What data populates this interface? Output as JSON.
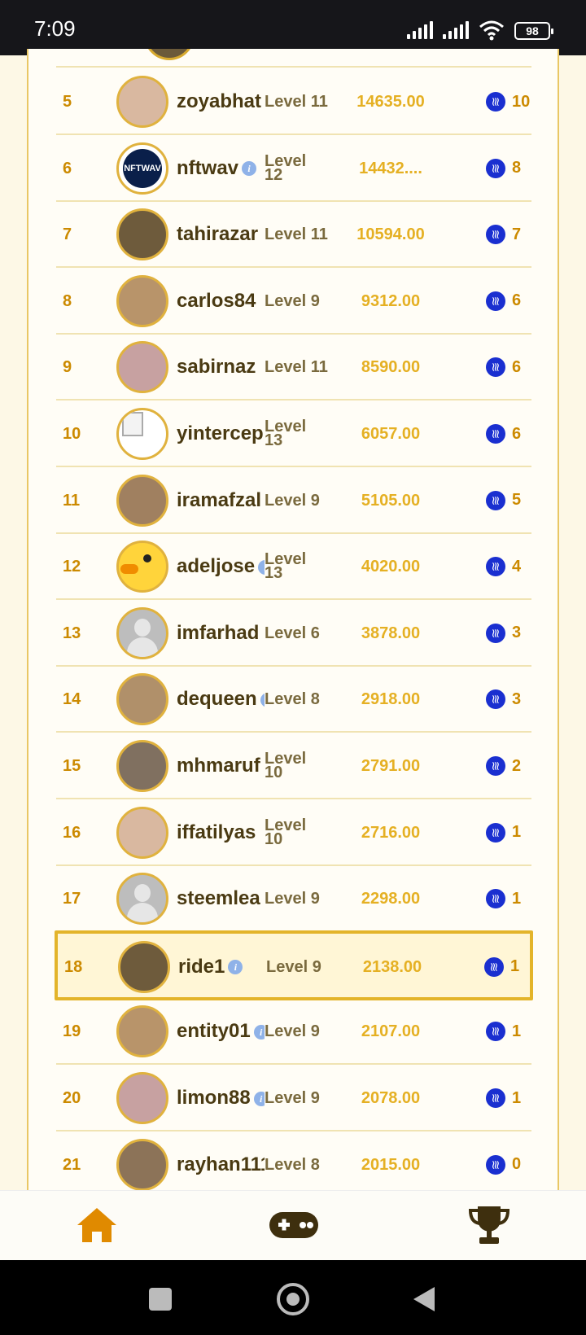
{
  "status_bar": {
    "time": "7:09",
    "battery": "98"
  },
  "colors": {
    "accent": "#e5b023",
    "rank": "#cc8a00",
    "name": "#4a3a12",
    "steem": "#1a2fd0",
    "highlight_border": "#e3b42a"
  },
  "leaderboard": [
    {
      "rank": "5",
      "name": "zoyabhat",
      "level": "Level 11",
      "score": "14635.00",
      "reward": "10",
      "avatar": "photo",
      "info": false
    },
    {
      "rank": "6",
      "name": "nftwav",
      "level": "Level 12",
      "score": "14432....",
      "reward": "8",
      "avatar": "nft-logo",
      "avatar_text": "NFTWAV",
      "info": true
    },
    {
      "rank": "7",
      "name": "tahirazar",
      "level": "Level 11",
      "score": "10594.00",
      "reward": "7",
      "avatar": "photo",
      "info": false
    },
    {
      "rank": "8",
      "name": "carlos84",
      "level": "Level 9",
      "score": "9312.00",
      "reward": "6",
      "avatar": "photo",
      "info": false
    },
    {
      "rank": "9",
      "name": "sabirnaz",
      "level": "Level 11",
      "score": "8590.00",
      "reward": "6",
      "avatar": "photo",
      "info": false
    },
    {
      "rank": "10",
      "name": "yintercep",
      "level": "Level 13",
      "score": "6057.00",
      "reward": "6",
      "avatar": "broken-image",
      "info": false
    },
    {
      "rank": "11",
      "name": "iramafzal",
      "level": "Level 9",
      "score": "5105.00",
      "reward": "5",
      "avatar": "photo",
      "info": false
    },
    {
      "rank": "12",
      "name": "adeljose",
      "level": "Level 13",
      "score": "4020.00",
      "reward": "4",
      "avatar": "duck",
      "info": true
    },
    {
      "rank": "13",
      "name": "imfarhad",
      "level": "Level 6",
      "score": "3878.00",
      "reward": "3",
      "avatar": "default",
      "info": false
    },
    {
      "rank": "14",
      "name": "dequeen",
      "level": "Level 8",
      "score": "2918.00",
      "reward": "3",
      "avatar": "photo",
      "info": true
    },
    {
      "rank": "15",
      "name": "mhmaruf",
      "level": "Level 10",
      "score": "2791.00",
      "reward": "2",
      "avatar": "photo",
      "info": false
    },
    {
      "rank": "16",
      "name": "iffatilyas",
      "level": "Level 10",
      "score": "2716.00",
      "reward": "1",
      "avatar": "photo",
      "info": false
    },
    {
      "rank": "17",
      "name": "steemlea",
      "level": "Level 9",
      "score": "2298.00",
      "reward": "1",
      "avatar": "default",
      "info": false
    },
    {
      "rank": "18",
      "name": "ride1",
      "level": "Level 9",
      "score": "2138.00",
      "reward": "1",
      "avatar": "photo",
      "info": true,
      "current_user": true
    },
    {
      "rank": "19",
      "name": "entity01",
      "level": "Level 9",
      "score": "2107.00",
      "reward": "1",
      "avatar": "photo",
      "info": true
    },
    {
      "rank": "20",
      "name": "limon88",
      "level": "Level 9",
      "score": "2078.00",
      "reward": "1",
      "avatar": "photo",
      "info": true
    },
    {
      "rank": "21",
      "name": "rayhan111",
      "level": "Level 8",
      "score": "2015.00",
      "reward": "0",
      "avatar": "photo",
      "info": false
    }
  ],
  "tabs": [
    {
      "id": "home",
      "icon": "home-icon",
      "active": true
    },
    {
      "id": "games",
      "icon": "gamepad-icon",
      "active": false
    },
    {
      "id": "leaderboard",
      "icon": "trophy-icon",
      "active": false
    }
  ],
  "system_nav": [
    "recent-apps-icon",
    "home-circle-icon",
    "back-icon"
  ]
}
